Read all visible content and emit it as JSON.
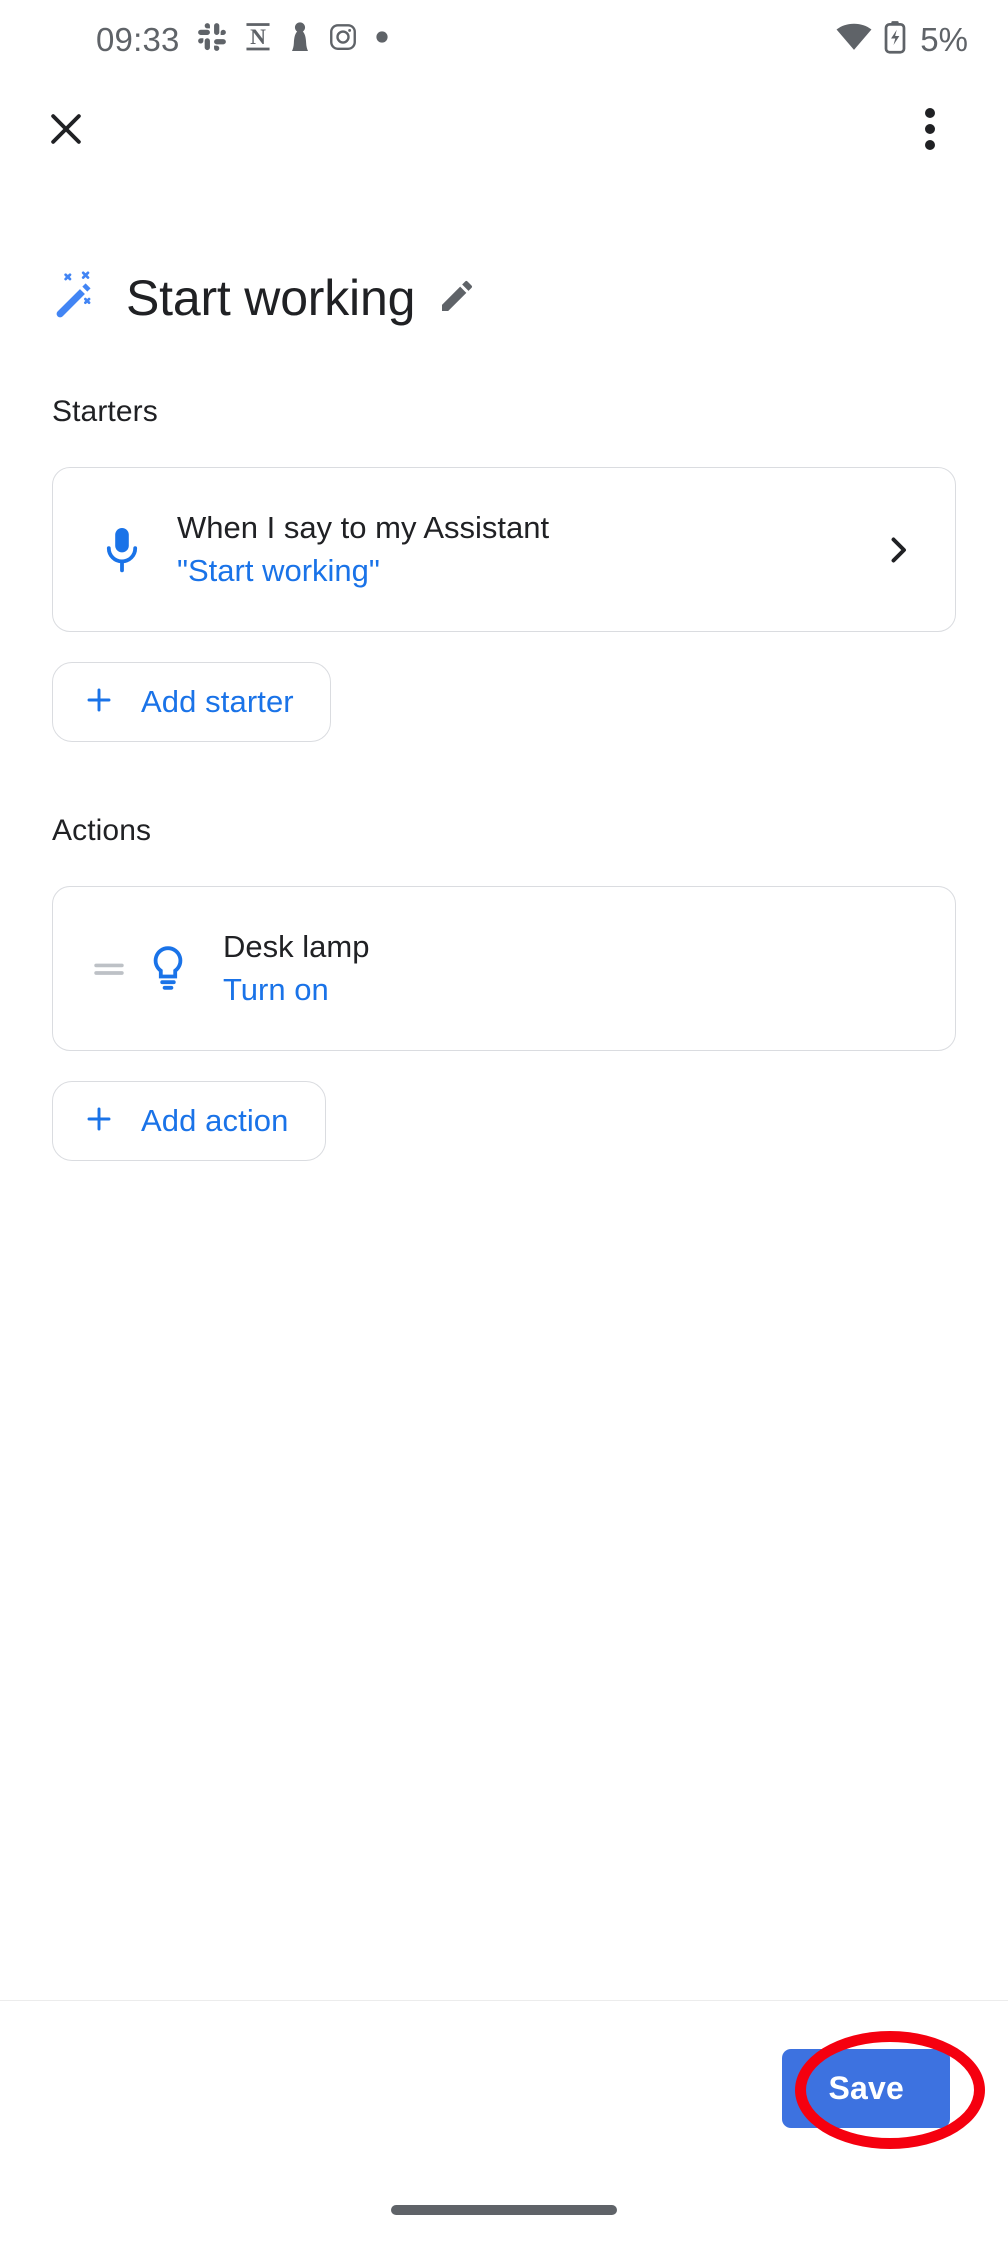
{
  "status_bar": {
    "time": "09:33",
    "left_icons": [
      {
        "name": "slack-icon"
      },
      {
        "name": "notion-icon"
      },
      {
        "name": "chess-pawn-icon"
      },
      {
        "name": "instagram-icon"
      },
      {
        "name": "notification-dot-icon"
      }
    ],
    "wifi_icon": "wifi-icon",
    "battery_icon": "battery-charging-icon",
    "battery_level": "5%",
    "icon_color": "#5f6368"
  },
  "app_bar": {
    "close_label": "close-icon",
    "overflow_label": "more-options-icon"
  },
  "routine": {
    "icon": "magic-wand-icon",
    "title": "Start working",
    "edit_icon": "pencil-edit-icon"
  },
  "starters": {
    "section_label": "Starters",
    "items": [
      {
        "icon": "microphone-icon",
        "title": "When I say to my Assistant",
        "subtitle": "\"Start working\"",
        "chevron": "chevron-right-icon"
      }
    ],
    "add_button": {
      "plus_icon": "plus-icon",
      "label": "Add starter"
    }
  },
  "actions": {
    "section_label": "Actions",
    "items": [
      {
        "drag_handle": "drag-handle-icon",
        "icon": "lightbulb-icon",
        "title": "Desk lamp",
        "subtitle": "Turn on"
      }
    ],
    "add_button": {
      "plus_icon": "plus-icon",
      "label": "Add action"
    }
  },
  "bottom_bar": {
    "save_label": "Save",
    "annotation": "red-highlight-oval"
  },
  "navigation": {
    "gesture_pill": "home-gesture-pill"
  },
  "colors": {
    "accent_blue": "#1a73e8",
    "save_blue": "#3d72e0",
    "text_primary": "#202124",
    "text_secondary": "#5f6368",
    "border": "#dadce0",
    "annotation_red": "#f5000f"
  }
}
